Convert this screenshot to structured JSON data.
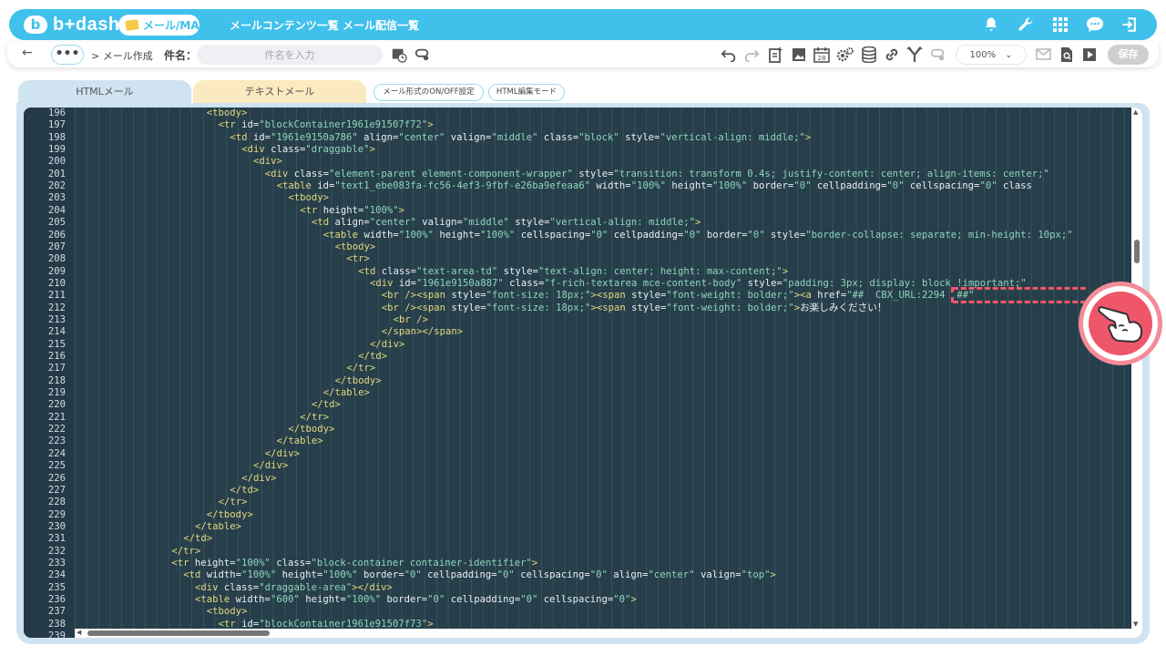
{
  "header": {
    "logo_text": "b+dash",
    "logo_mark": "b",
    "module_label": "メール/MA",
    "nav": [
      "メールコンテンツ一覧",
      "メール配信一覧"
    ],
    "icons": [
      "bell-icon",
      "wrench-icon",
      "grid-icon",
      "chat-icon",
      "logout-icon"
    ]
  },
  "toolbar": {
    "back_glyph": "←",
    "more_label": "•••",
    "breadcrumb": "> メール作成",
    "subject_label": "件名：",
    "subject_placeholder": "件名を入力",
    "zoom_value": "100%",
    "save_label": "保存"
  },
  "tabs": {
    "html_label": "HTMLメール",
    "text_label": "テキストメール",
    "toggle_format_label": "メール形式のON/OFF設定",
    "html_edit_mode_label": "HTML編集モード"
  },
  "editor": {
    "lines": [
      {
        "n": "196",
        "indent": 22,
        "parts": [
          [
            "tag",
            "<tbody>"
          ]
        ]
      },
      {
        "n": "197",
        "indent": 24,
        "parts": [
          [
            "tag",
            "<tr "
          ],
          [
            "attr",
            "id="
          ],
          [
            "str",
            "\"blockContainer1961e91507f72\""
          ],
          [
            "tag",
            ">"
          ]
        ]
      },
      {
        "n": "198",
        "indent": 26,
        "parts": [
          [
            "tag",
            "<td "
          ],
          [
            "attr",
            "id="
          ],
          [
            "str",
            "\"1961e9150a786\""
          ],
          [
            "attr",
            " align="
          ],
          [
            "str",
            "\"center\""
          ],
          [
            "attr",
            " valign="
          ],
          [
            "str",
            "\"middle\""
          ],
          [
            "attr",
            " class="
          ],
          [
            "str",
            "\"block\""
          ],
          [
            "attr",
            " style="
          ],
          [
            "str",
            "\"vertical-align: middle;\""
          ],
          [
            "tag",
            ">"
          ]
        ]
      },
      {
        "n": "199",
        "indent": 28,
        "parts": [
          [
            "tag",
            "<div "
          ],
          [
            "attr",
            "class="
          ],
          [
            "str",
            "\"draggable\""
          ],
          [
            "tag",
            ">"
          ]
        ]
      },
      {
        "n": "200",
        "indent": 30,
        "parts": [
          [
            "tag",
            "<div>"
          ]
        ]
      },
      {
        "n": "201",
        "indent": 32,
        "parts": [
          [
            "tag",
            "<div "
          ],
          [
            "attr",
            "class="
          ],
          [
            "str",
            "\"element-parent element-component-wrapper\""
          ],
          [
            "attr",
            " style="
          ],
          [
            "str",
            "\"transition: transform 0.4s; justify-content: center; align-items: center;\""
          ]
        ]
      },
      {
        "n": "202",
        "indent": 34,
        "parts": [
          [
            "tag",
            "<table "
          ],
          [
            "attr",
            "id="
          ],
          [
            "str",
            "\"text1_ebe083fa-fc56-4ef3-9fbf-e26ba9efeaa6\""
          ],
          [
            "attr",
            " width="
          ],
          [
            "str",
            "\"100%\""
          ],
          [
            "attr",
            " height="
          ],
          [
            "str",
            "\"100%\""
          ],
          [
            "attr",
            " border="
          ],
          [
            "str",
            "\"0\""
          ],
          [
            "attr",
            " cellpadding="
          ],
          [
            "str",
            "\"0\""
          ],
          [
            "attr",
            " cellspacing="
          ],
          [
            "str",
            "\"0\""
          ],
          [
            "attr",
            " class"
          ]
        ]
      },
      {
        "n": "203",
        "indent": 36,
        "parts": [
          [
            "tag",
            "<tbody>"
          ]
        ]
      },
      {
        "n": "204",
        "indent": 38,
        "parts": [
          [
            "tag",
            "<tr "
          ],
          [
            "attr",
            "height="
          ],
          [
            "str",
            "\"100%\""
          ],
          [
            "tag",
            ">"
          ]
        ]
      },
      {
        "n": "205",
        "indent": 40,
        "parts": [
          [
            "tag",
            "<td "
          ],
          [
            "attr",
            "align="
          ],
          [
            "str",
            "\"center\""
          ],
          [
            "attr",
            " valign="
          ],
          [
            "str",
            "\"middle\""
          ],
          [
            "attr",
            " style="
          ],
          [
            "str",
            "\"vertical-align: middle;\""
          ],
          [
            "tag",
            ">"
          ]
        ]
      },
      {
        "n": "206",
        "indent": 42,
        "parts": [
          [
            "tag",
            "<table "
          ],
          [
            "attr",
            "width="
          ],
          [
            "str",
            "\"100%\""
          ],
          [
            "attr",
            " height="
          ],
          [
            "str",
            "\"100%\""
          ],
          [
            "attr",
            " cellspacing="
          ],
          [
            "str",
            "\"0\""
          ],
          [
            "attr",
            " cellpadding="
          ],
          [
            "str",
            "\"0\""
          ],
          [
            "attr",
            " border="
          ],
          [
            "str",
            "\"0\""
          ],
          [
            "attr",
            " style="
          ],
          [
            "str",
            "\"border-collapse: separate; min-height: 10px;\""
          ]
        ]
      },
      {
        "n": "207",
        "indent": 44,
        "parts": [
          [
            "tag",
            "<tbody>"
          ]
        ]
      },
      {
        "n": "208",
        "indent": 46,
        "parts": [
          [
            "tag",
            "<tr>"
          ]
        ]
      },
      {
        "n": "209",
        "indent": 48,
        "parts": [
          [
            "tag",
            "<td "
          ],
          [
            "attr",
            "class="
          ],
          [
            "str",
            "\"text-area-td\""
          ],
          [
            "attr",
            " style="
          ],
          [
            "str",
            "\"text-align: center; height: max-content;\""
          ],
          [
            "tag",
            ">"
          ]
        ]
      },
      {
        "n": "210",
        "indent": 50,
        "parts": [
          [
            "tag",
            "<div "
          ],
          [
            "attr",
            "id="
          ],
          [
            "str",
            "\"1961e9150a887\""
          ],
          [
            "attr",
            " class="
          ],
          [
            "str",
            "\"f-rich-textarea mce-content-body\""
          ],
          [
            "attr",
            " style="
          ],
          [
            "str",
            "\"padding: 3px; display: block !important;\""
          ]
        ]
      },
      {
        "n": "211",
        "indent": 52,
        "parts": [
          [
            "tag",
            "<br /><span "
          ],
          [
            "attr",
            "style="
          ],
          [
            "str",
            "\"font-size: 18px;\""
          ],
          [
            "tag",
            "><span "
          ],
          [
            "attr",
            "style="
          ],
          [
            "str",
            "\"font-weight: bolder;\""
          ],
          [
            "tag",
            "><a "
          ],
          [
            "attr",
            "href="
          ],
          [
            "str",
            "\"##  CBX_URL:2294  ##\""
          ]
        ]
      },
      {
        "n": "212",
        "indent": 52,
        "parts": [
          [
            "tag",
            "<br /><span "
          ],
          [
            "attr",
            "style="
          ],
          [
            "str",
            "\"font-size: 18px;\""
          ],
          [
            "tag",
            "><span "
          ],
          [
            "attr",
            "style="
          ],
          [
            "str",
            "\"font-weight: bolder;\""
          ],
          [
            "tag",
            ">"
          ],
          [
            "txt",
            "お楽しみください！"
          ]
        ]
      },
      {
        "n": "213",
        "indent": 54,
        "parts": [
          [
            "tag",
            "<br />"
          ]
        ]
      },
      {
        "n": "214",
        "indent": 52,
        "parts": [
          [
            "tag",
            "</span></span>"
          ]
        ]
      },
      {
        "n": "215",
        "indent": 50,
        "parts": [
          [
            "tag",
            "</div>"
          ]
        ]
      },
      {
        "n": "216",
        "indent": 48,
        "parts": [
          [
            "tag",
            "</td>"
          ]
        ]
      },
      {
        "n": "217",
        "indent": 46,
        "parts": [
          [
            "tag",
            "</tr>"
          ]
        ]
      },
      {
        "n": "218",
        "indent": 44,
        "parts": [
          [
            "tag",
            "</tbody>"
          ]
        ]
      },
      {
        "n": "219",
        "indent": 42,
        "parts": [
          [
            "tag",
            "</table>"
          ]
        ]
      },
      {
        "n": "220",
        "indent": 40,
        "parts": [
          [
            "tag",
            "</td>"
          ]
        ]
      },
      {
        "n": "221",
        "indent": 38,
        "parts": [
          [
            "tag",
            "</tr>"
          ]
        ]
      },
      {
        "n": "222",
        "indent": 36,
        "parts": [
          [
            "tag",
            "</tbody>"
          ]
        ]
      },
      {
        "n": "223",
        "indent": 34,
        "parts": [
          [
            "tag",
            "</table>"
          ]
        ]
      },
      {
        "n": "224",
        "indent": 32,
        "parts": [
          [
            "tag",
            "</div>"
          ]
        ]
      },
      {
        "n": "225",
        "indent": 30,
        "parts": [
          [
            "tag",
            "</div>"
          ]
        ]
      },
      {
        "n": "226",
        "indent": 28,
        "parts": [
          [
            "tag",
            "</div>"
          ]
        ]
      },
      {
        "n": "227",
        "indent": 26,
        "parts": [
          [
            "tag",
            "</td>"
          ]
        ]
      },
      {
        "n": "228",
        "indent": 24,
        "parts": [
          [
            "tag",
            "</tr>"
          ]
        ]
      },
      {
        "n": "229",
        "indent": 22,
        "parts": [
          [
            "tag",
            "</tbody>"
          ]
        ]
      },
      {
        "n": "230",
        "indent": 20,
        "parts": [
          [
            "tag",
            "</table>"
          ]
        ]
      },
      {
        "n": "231",
        "indent": 18,
        "parts": [
          [
            "tag",
            "</td>"
          ]
        ]
      },
      {
        "n": "232",
        "indent": 16,
        "parts": [
          [
            "tag",
            "</tr>"
          ]
        ]
      },
      {
        "n": "233",
        "indent": 16,
        "parts": [
          [
            "tag",
            "<tr "
          ],
          [
            "attr",
            "height="
          ],
          [
            "str",
            "\"100%\""
          ],
          [
            "attr",
            " class="
          ],
          [
            "str",
            "\"block-container container-identifier\""
          ],
          [
            "tag",
            ">"
          ]
        ]
      },
      {
        "n": "234",
        "indent": 18,
        "parts": [
          [
            "tag",
            "<td "
          ],
          [
            "attr",
            "width="
          ],
          [
            "str",
            "\"100%\""
          ],
          [
            "attr",
            " height="
          ],
          [
            "str",
            "\"100%\""
          ],
          [
            "attr",
            " border="
          ],
          [
            "str",
            "\"0\""
          ],
          [
            "attr",
            " cellpadding="
          ],
          [
            "str",
            "\"0\""
          ],
          [
            "attr",
            " cellspacing="
          ],
          [
            "str",
            "\"0\""
          ],
          [
            "attr",
            " align="
          ],
          [
            "str",
            "\"center\""
          ],
          [
            "attr",
            " valign="
          ],
          [
            "str",
            "\"top\""
          ],
          [
            "tag",
            ">"
          ]
        ]
      },
      {
        "n": "235",
        "indent": 20,
        "parts": [
          [
            "tag",
            "<div "
          ],
          [
            "attr",
            "class="
          ],
          [
            "str",
            "\"draggable-area\""
          ],
          [
            "tag",
            "></div>"
          ]
        ]
      },
      {
        "n": "236",
        "indent": 20,
        "parts": [
          [
            "tag",
            "<table "
          ],
          [
            "attr",
            "width="
          ],
          [
            "str",
            "\"600\""
          ],
          [
            "attr",
            " height="
          ],
          [
            "str",
            "\"100%\""
          ],
          [
            "attr",
            " border="
          ],
          [
            "str",
            "\"0\""
          ],
          [
            "attr",
            " cellpadding="
          ],
          [
            "str",
            "\"0\""
          ],
          [
            "attr",
            " cellspacing="
          ],
          [
            "str",
            "\"0\""
          ],
          [
            "tag",
            ">"
          ]
        ]
      },
      {
        "n": "237",
        "indent": 22,
        "parts": [
          [
            "tag",
            "<tbody>"
          ]
        ]
      },
      {
        "n": "238",
        "indent": 24,
        "parts": [
          [
            "tag",
            "<tr "
          ],
          [
            "attr",
            "id="
          ],
          [
            "str",
            "\"blockContainer1961e91507f73\""
          ],
          [
            "tag",
            ">"
          ]
        ]
      },
      {
        "n": "239",
        "indent": 26,
        "parts": []
      }
    ]
  },
  "colors": {
    "brand": "#3fc1ec",
    "editor_bg": "#263f4b",
    "tag": "#e3d67d",
    "string": "#8fd5b8",
    "highlight": "#f0566a"
  }
}
